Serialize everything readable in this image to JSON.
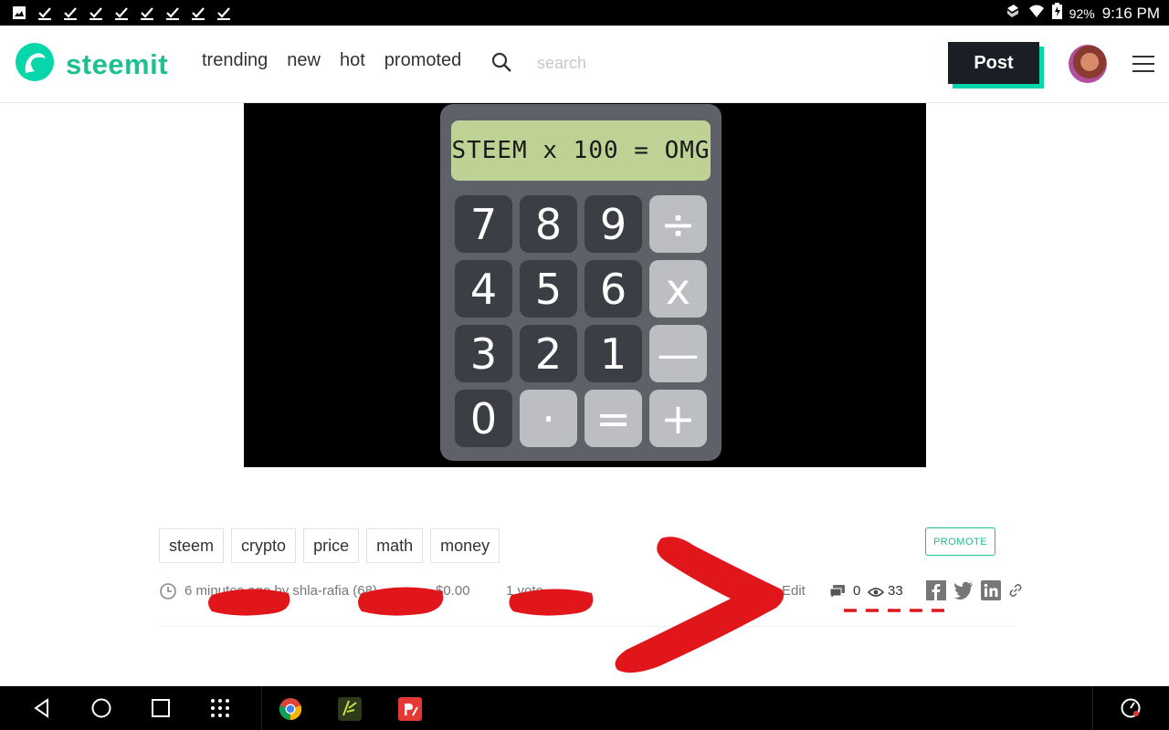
{
  "status_bar": {
    "battery_pct": "92%",
    "time": "9:16 PM"
  },
  "header": {
    "logo_text": "steemit",
    "nav": [
      "trending",
      "new",
      "hot",
      "promoted"
    ],
    "search_placeholder": "search",
    "post_button": "Post"
  },
  "post_image": {
    "display_text": "STEEM x 100 = OMG",
    "keys": [
      "7",
      "8",
      "9",
      "÷",
      "4",
      "5",
      "6",
      "x",
      "3",
      "2",
      "1",
      "—",
      "0",
      "·",
      "=",
      "+"
    ]
  },
  "tags": [
    "steem",
    "crypto",
    "price",
    "math",
    "money"
  ],
  "promote_label": "PROMOTE",
  "meta": {
    "time_author": "6 minutes ago by shla-rafia (68)",
    "payout": "$0.00",
    "votes": "1 vote",
    "edit": "Edit",
    "replies": "0",
    "views": "33"
  },
  "colors": {
    "brand": "#1fbf8f",
    "post_button_bg": "#1a1f26",
    "annotation": "#e0161a"
  }
}
